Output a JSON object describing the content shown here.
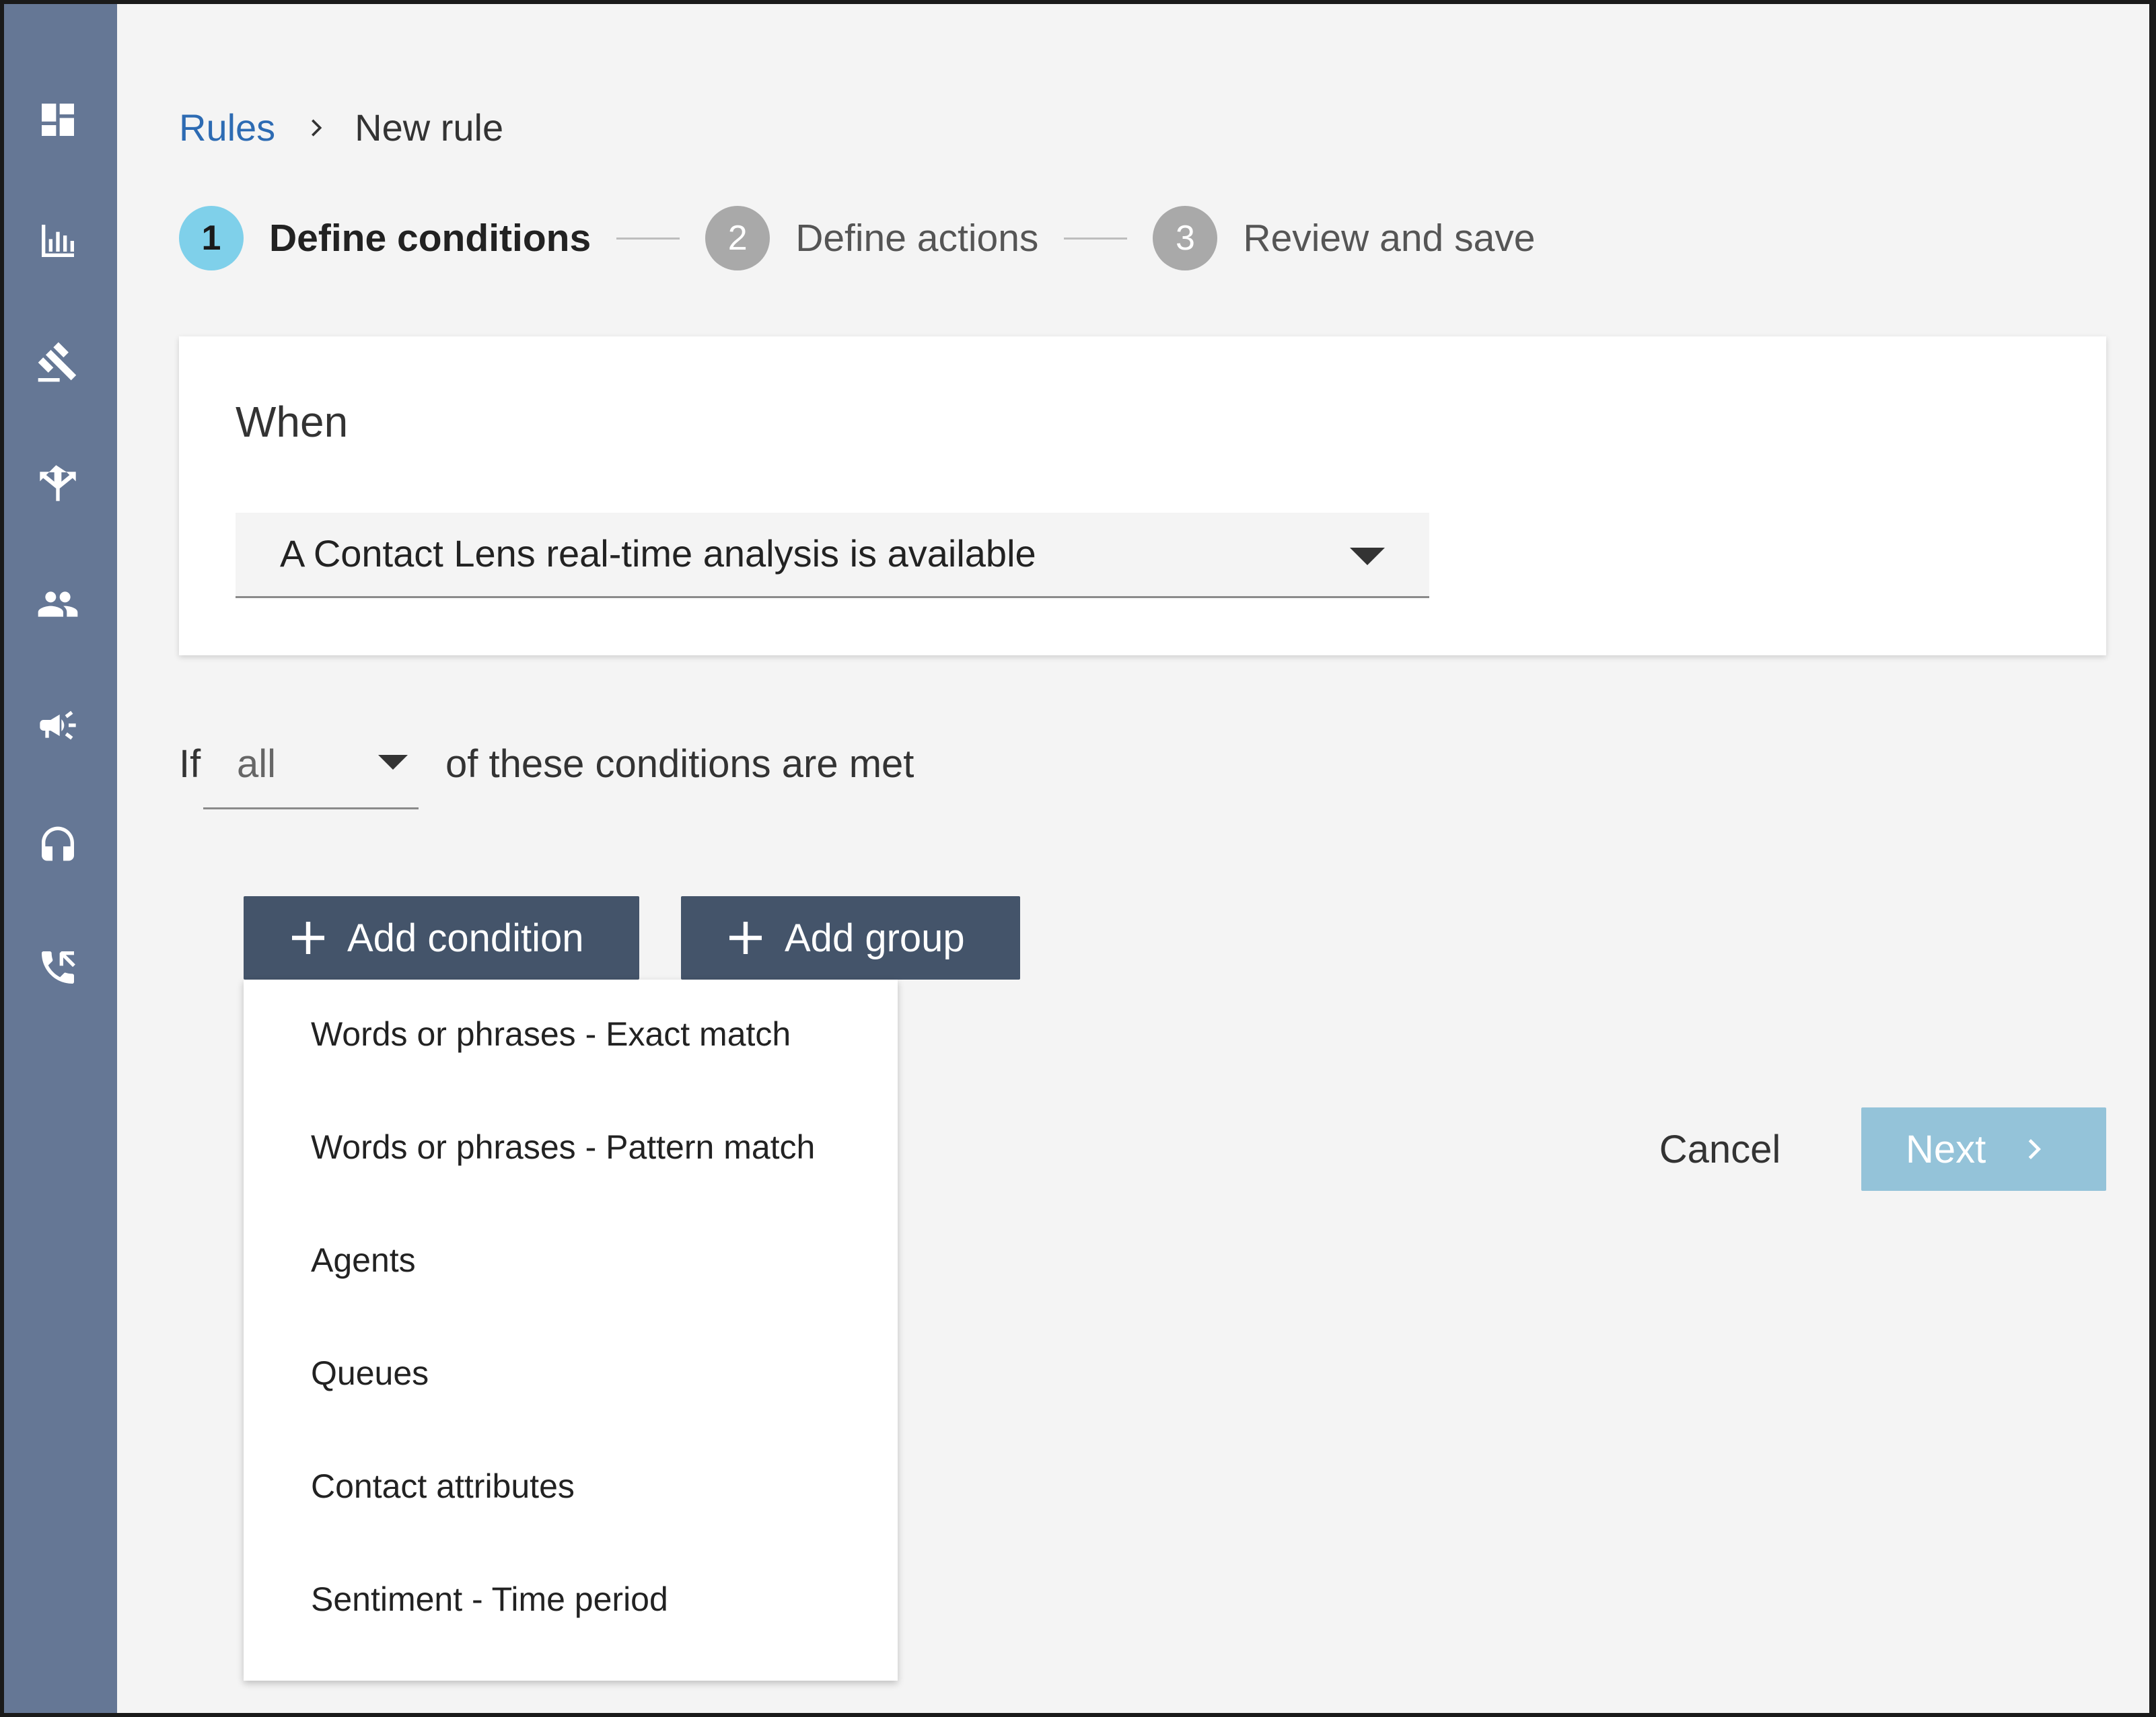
{
  "sidebar": {
    "items": [
      {
        "icon": "dashboard-icon"
      },
      {
        "icon": "bar-chart-icon"
      },
      {
        "icon": "gavel-icon"
      },
      {
        "icon": "routing-icon"
      },
      {
        "icon": "users-icon"
      },
      {
        "icon": "megaphone-icon"
      },
      {
        "icon": "headset-icon"
      },
      {
        "icon": "phone-icon"
      }
    ]
  },
  "breadcrumb": {
    "parent": "Rules",
    "current": "New rule"
  },
  "stepper": {
    "steps": [
      {
        "number": "1",
        "label": "Define conditions",
        "active": true
      },
      {
        "number": "2",
        "label": "Define actions",
        "active": false
      },
      {
        "number": "3",
        "label": "Review and save",
        "active": false
      }
    ]
  },
  "when": {
    "title": "When",
    "event_value": "A Contact Lens real-time analysis is available"
  },
  "conditions": {
    "prefix": "If",
    "match_value": "all",
    "suffix": "of these conditions are met"
  },
  "buttons": {
    "add_condition": "Add condition",
    "add_group": "Add group",
    "cancel": "Cancel",
    "next": "Next"
  },
  "condition_menu": {
    "items": [
      "Words or phrases - Exact match",
      "Words or phrases - Pattern match",
      "Agents",
      "Queues",
      "Contact attributes",
      "Sentiment - Time period"
    ]
  },
  "colors": {
    "sidebar": "#657795",
    "link": "#2d6bb3",
    "active_step": "#7fd0ea",
    "inactive_step": "#a9a9a9",
    "dark_button": "#44546a",
    "next_button_disabled": "#94c3d9"
  }
}
